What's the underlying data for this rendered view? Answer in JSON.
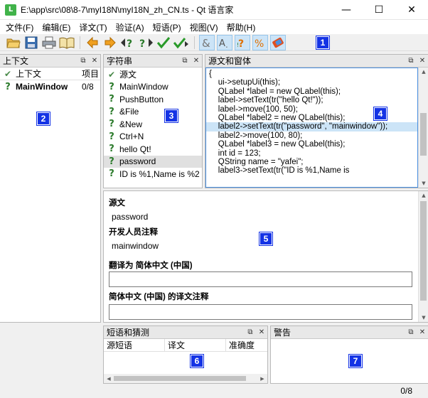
{
  "window": {
    "title": "E:\\app\\src\\08\\8-7\\myI18N\\myI18N_zh_CN.ts - Qt 语言家",
    "app_icon_letter": "L",
    "minimize": "—",
    "maximize": "☐",
    "close": "✕"
  },
  "menu": [
    "文件(F)",
    "编辑(E)",
    "译文(T)",
    "验证(A)",
    "短语(P)",
    "视图(V)",
    "帮助(H)"
  ],
  "badges": [
    "1",
    "2",
    "3",
    "4",
    "5",
    "6",
    "7"
  ],
  "context_dock": {
    "title": "上下文",
    "columns": [
      "上下文",
      "项目"
    ],
    "rows": [
      {
        "name": "MainWindow",
        "count": "0/8"
      }
    ]
  },
  "strings_dock": {
    "title": "字符串",
    "header": "源文",
    "items": [
      "MainWindow",
      "PushButton",
      "&File",
      "&New",
      "Ctrl+N",
      "hello Qt!",
      "password",
      "ID is %1,Name is %2"
    ],
    "selected_index": 6
  },
  "source_dock": {
    "title": "源文和窗体",
    "lines": [
      "{",
      "    ui->setupUi(this);",
      "",
      "    QLabel *label = new QLabel(this);",
      "    label->setText(tr(\"hello Qt!\"));",
      "    label->move(100, 50);",
      "    QLabel *label2 = new QLabel(this);",
      "    label2->setText(tr(\"password\", \"mainwindow\"));",
      "    label2->move(100, 80);",
      "    QLabel *label3 = new QLabel(this);",
      "    int id = 123;",
      "    QString name = \"yafei\";",
      "    label3->setText(tr(\"ID is %1,Name is"
    ],
    "highlight_index": 7
  },
  "editor": {
    "source_label": "源文",
    "source_value": "password",
    "dev_comment_label": "开发人员注释",
    "dev_comment_value": "mainwindow",
    "translation_label": "翻译为 简体中文 (中国)",
    "translation_value": "",
    "trans_comment_label": "简体中文 (中国) 的译文注释",
    "trans_comment_value": ""
  },
  "phrases_dock": {
    "title": "短语和猜测",
    "columns": [
      "源短语",
      "译文",
      "准确度"
    ]
  },
  "warnings_dock": {
    "title": "警告"
  },
  "status": {
    "progress": "0/8"
  },
  "dock_controls": {
    "float": "⧉",
    "close": "✕"
  }
}
